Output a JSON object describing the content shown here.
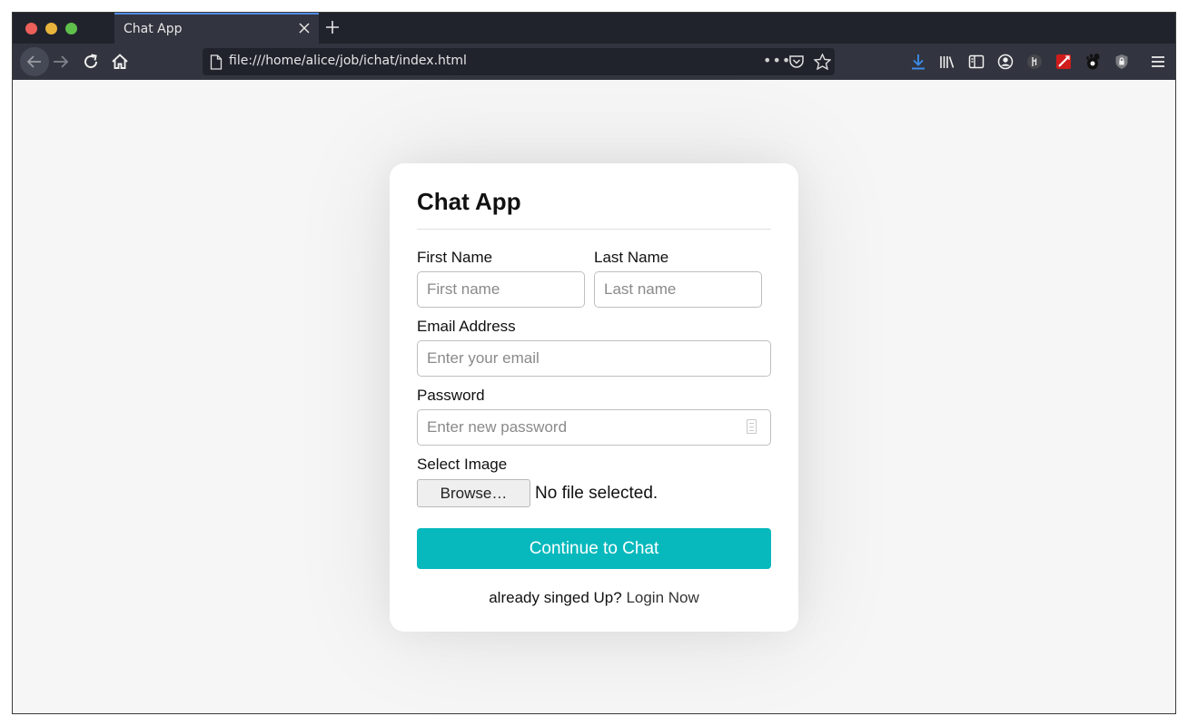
{
  "browser": {
    "tab_title": "Chat App",
    "url": "file:///home/alice/job/ichat/index.html",
    "url_overflow": "•••",
    "accent_color": "#4f8ce8",
    "toolbar_icons": [
      "download-icon",
      "library-icon",
      "sidebar-icon",
      "account-icon",
      "extension-icon",
      "extension-red-icon",
      "gnome-extension-icon",
      "shield-icon",
      "menu-icon"
    ]
  },
  "form": {
    "title": "Chat App",
    "first_name_label": "First Name",
    "first_name_placeholder": "First name",
    "first_name_value": "",
    "last_name_label": "Last Name",
    "last_name_placeholder": "Last name",
    "last_name_value": "",
    "email_label": "Email Address",
    "email_placeholder": "Enter your email",
    "email_value": "",
    "password_label": "Password",
    "password_placeholder": "Enter new password",
    "password_value": "",
    "image_label": "Select Image",
    "browse_label": "Browse…",
    "file_status": "No file selected.",
    "submit_label": "Continue to Chat",
    "submit_color": "#07b9bd",
    "signup_text": "already singed Up?",
    "login_link": "Login Now"
  }
}
